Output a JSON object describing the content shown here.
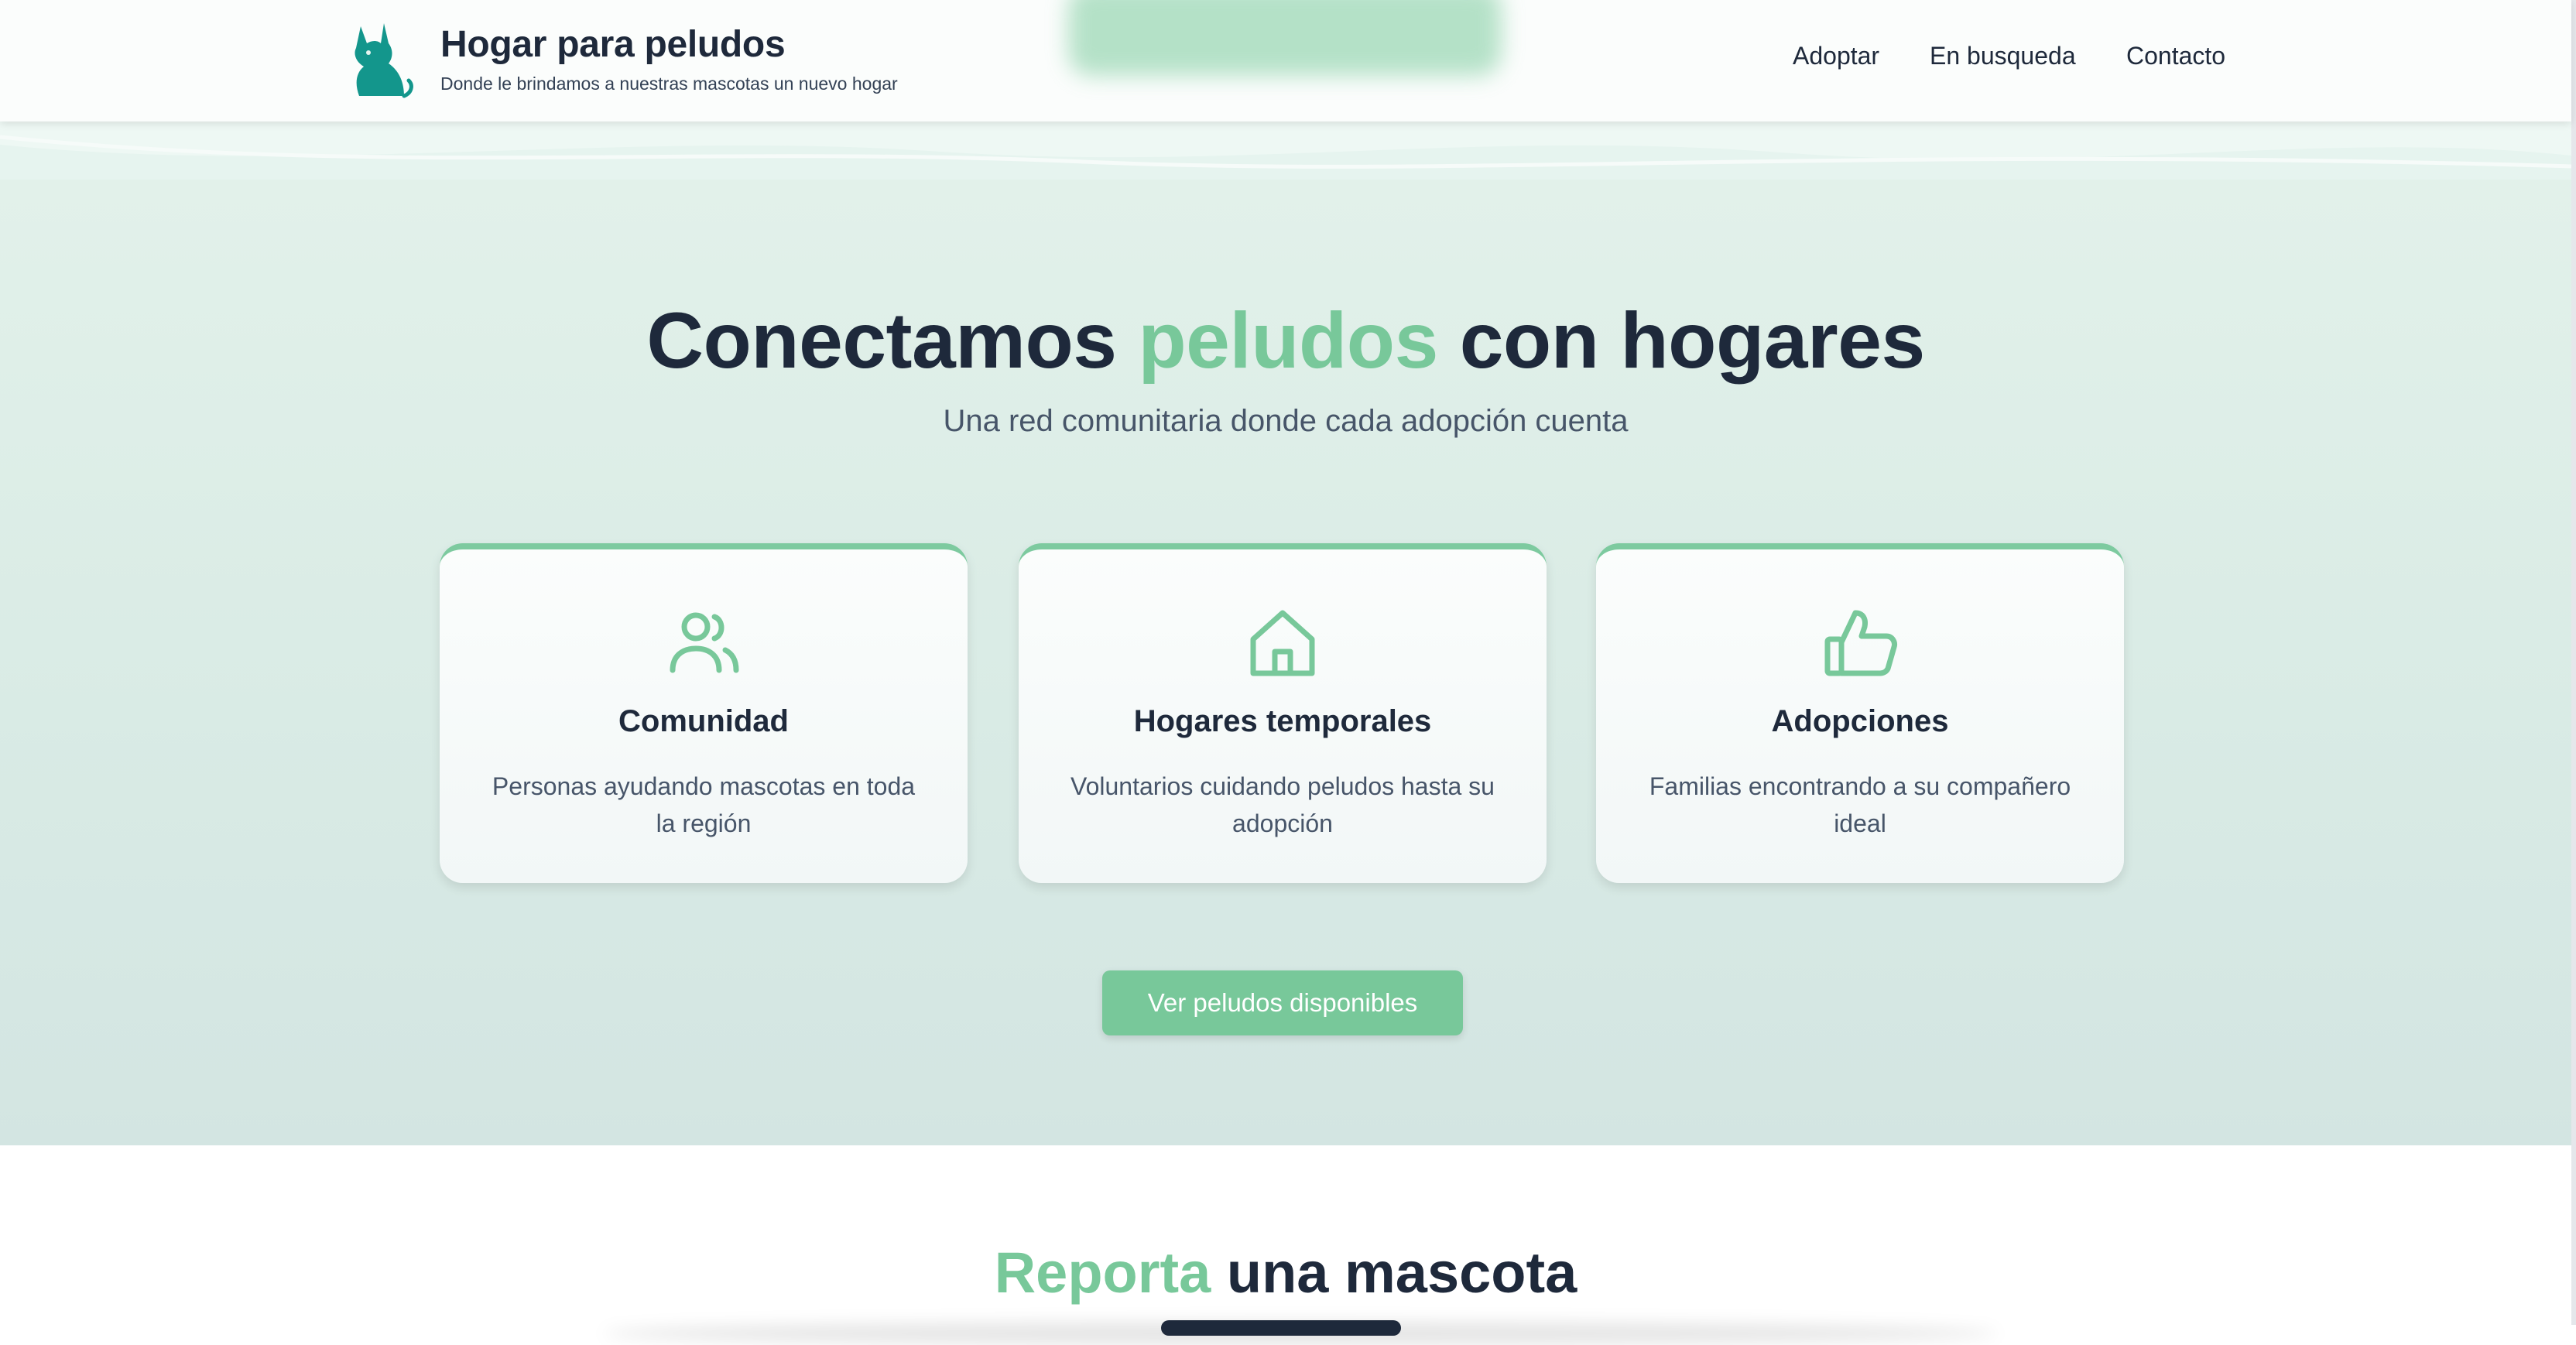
{
  "header": {
    "brand_title": "Hogar para peludos",
    "brand_subtitle": "Donde le brindamos a nuestras mascotas un nuevo hogar",
    "nav": [
      "Adoptar",
      "En busqueda",
      "Contacto"
    ]
  },
  "hero": {
    "title_before": "Conectamos ",
    "title_accent": "peludos",
    "title_after": " con hogares",
    "subtitle": "Una red comunitaria donde cada adopción cuenta",
    "cta": "Ver peludos disponibles"
  },
  "cards": [
    {
      "icon": "users-icon",
      "title": "Comunidad",
      "text": "Personas ayudando mascotas en toda la región"
    },
    {
      "icon": "home-icon",
      "title": "Hogares temporales",
      "text": "Voluntarios cuidando peludos hasta su adopción"
    },
    {
      "icon": "thumbs-up-icon",
      "title": "Adopciones",
      "text": "Familias encontrando a su compañero ideal"
    }
  ],
  "report": {
    "title_accent": "Reporta",
    "title_rest": " una mascota"
  },
  "colors": {
    "accent": "#78c89a",
    "brand_teal": "#13968c",
    "text_dark": "#1e293b"
  }
}
